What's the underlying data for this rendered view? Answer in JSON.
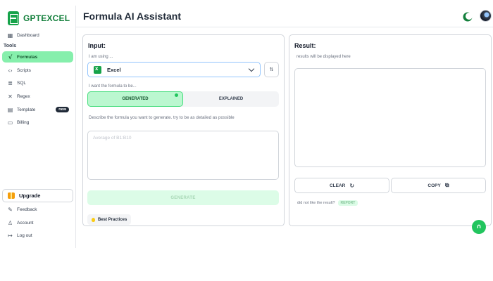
{
  "brand": {
    "name": "GPTEXCEL",
    "accent": "#22c55e"
  },
  "header": {
    "title": "Formula AI Assistant"
  },
  "sidebar": {
    "dashboard_label": "Dashboard",
    "section_label": "Tools",
    "items": [
      {
        "label": "Formulas",
        "icon": "function-icon",
        "active": true
      },
      {
        "label": "Scripts",
        "icon": "code-icon"
      },
      {
        "label": "SQL",
        "icon": "database-icon"
      },
      {
        "label": "Regex",
        "icon": "regex-icon"
      },
      {
        "label": "Template",
        "icon": "template-icon",
        "badge": "new"
      },
      {
        "label": "Billing",
        "icon": "billing-icon"
      }
    ],
    "upgrade_label": "Upgrade",
    "bottom_items": [
      {
        "label": "Feedback",
        "icon": "feedback-icon"
      },
      {
        "label": "Account",
        "icon": "user-icon"
      },
      {
        "label": "Log out",
        "icon": "logout-icon"
      }
    ]
  },
  "input_panel": {
    "title": "Input:",
    "using_label": "I am using ...",
    "selected_app": "Excel",
    "mode_label": "I want the formula to be...",
    "modes": [
      "GENERATED",
      "EXPLAINED"
    ],
    "active_mode": "GENERATED",
    "describe_label": "Describe the formula you want to generate. try to be as detailed as possible",
    "placeholder": "Average of B1:B10",
    "generate_label": "GENERATE",
    "best_practices_label": "Best Practices"
  },
  "result_panel": {
    "title": "Result:",
    "hint": "results will be displayed here",
    "clear_label": "CLEAR",
    "copy_label": "COPY",
    "dislike_label": "did not like the result?",
    "report_label": "REPORT"
  }
}
